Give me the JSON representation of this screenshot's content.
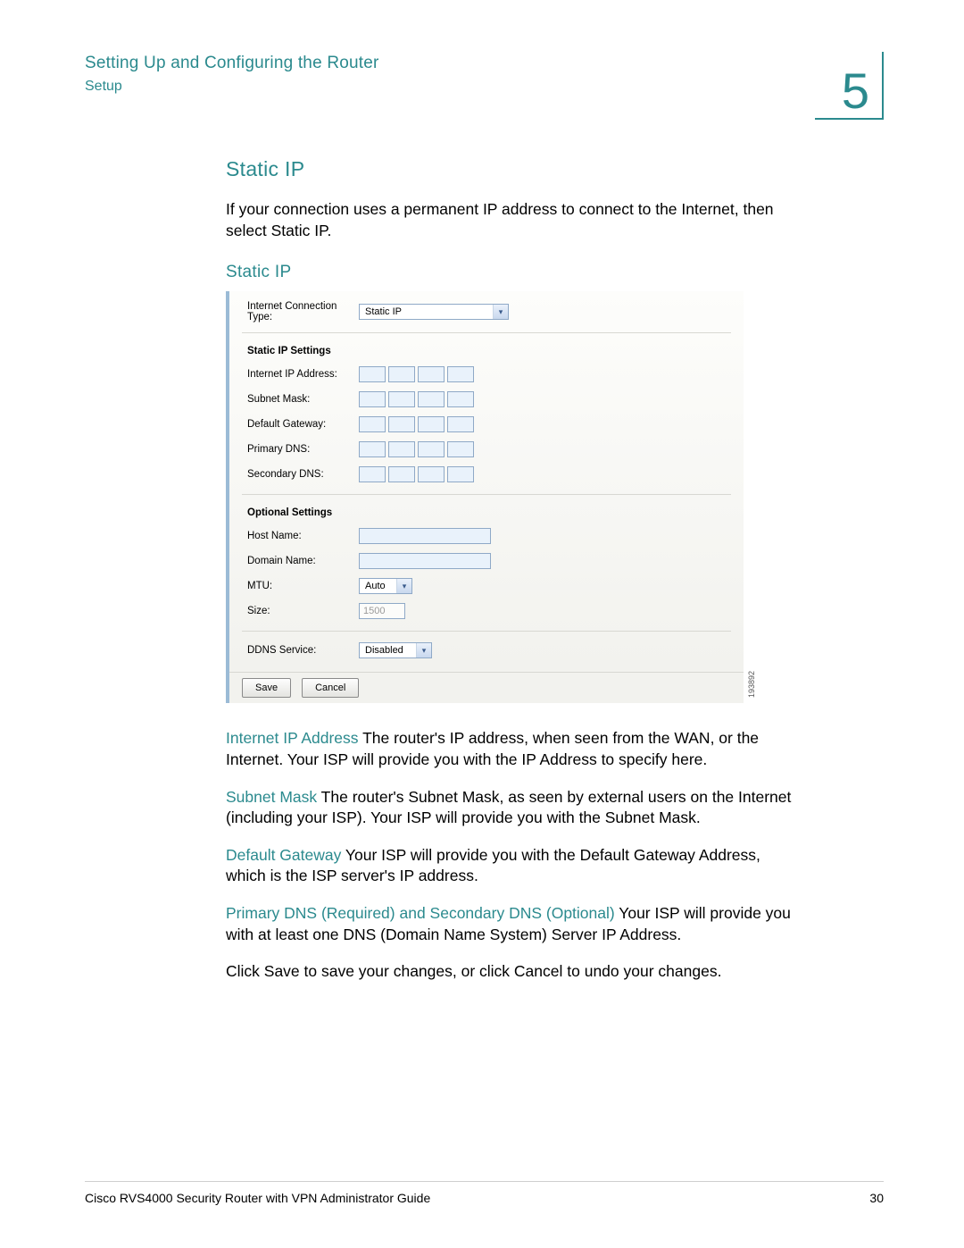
{
  "header": {
    "chapter_title": "Setting Up and Configuring the Router",
    "section": "Setup",
    "chapter_number": "5"
  },
  "headings": {
    "h2": "Static IP",
    "h3": "Static IP"
  },
  "intro_text": "If your connection uses a permanent IP address to connect to the Internet, then select Static IP.",
  "screenshot": {
    "conn_type_label": "Internet Connection Type:",
    "conn_type_value": "Static IP",
    "sec1": "Static IP Settings",
    "rows_ip": {
      "ip": "Internet IP Address:",
      "mask": "Subnet Mask:",
      "gw": "Default Gateway:",
      "pdns": "Primary DNS:",
      "sdns": "Secondary DNS:"
    },
    "sec2": "Optional Settings",
    "rows_opt": {
      "host": "Host Name:",
      "domain": "Domain Name:",
      "mtu": "MTU:",
      "mtu_value": "Auto",
      "size": "Size:",
      "size_value": "1500"
    },
    "ddns_label": "DDNS Service:",
    "ddns_value": "Disabled",
    "save": "Save",
    "cancel": "Cancel",
    "ref": "193892"
  },
  "definitions": {
    "ip_term": "Internet IP Address",
    "ip_text": " The router's IP address, when seen from the WAN, or the Internet. Your ISP will provide you with the IP Address to specify here.",
    "mask_term": "Subnet Mask",
    "mask_text": " The router's Subnet Mask, as seen by external users on the Internet (including your ISP). Your ISP will provide you with the Subnet Mask.",
    "gw_term": "Default Gateway",
    "gw_text": " Your ISP will provide you with the Default Gateway Address, which is the ISP server's IP address.",
    "dns_term": "Primary DNS (Required) and Secondary DNS (Optional)",
    "dns_text": " Your ISP will provide you with at least one DNS (Domain Name System) Server IP Address."
  },
  "closing_text": "Click Save to save your changes, or click Cancel to undo your changes.",
  "footer": {
    "guide": "Cisco RVS4000 Security Router with VPN Administrator Guide",
    "page": "30"
  }
}
